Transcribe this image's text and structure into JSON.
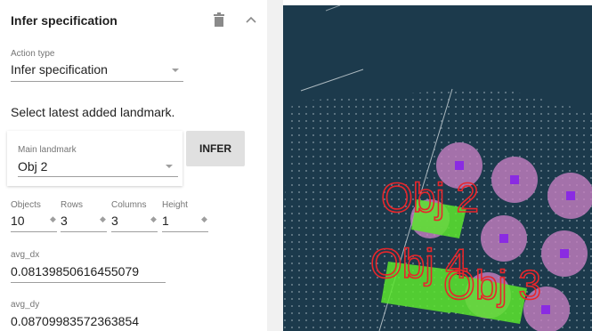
{
  "panel": {
    "title": "Infer specification",
    "icons": {
      "delete": "trash-icon",
      "collapse": "chevron-up-icon"
    },
    "action_type": {
      "label": "Action type",
      "value": "Infer specification"
    },
    "helper_text": "Select latest added landmark.",
    "main_landmark": {
      "label": "Main landmark",
      "value": "Obj 2"
    },
    "infer_button": "INFER",
    "fields": {
      "objects": {
        "label": "Objects",
        "value": "10"
      },
      "rows": {
        "label": "Rows",
        "value": "3"
      },
      "columns": {
        "label": "Columns",
        "value": "3"
      },
      "height": {
        "label": "Height",
        "value": "1"
      }
    },
    "avg_dx": {
      "label": "avg_dx",
      "value": "0.08139850616455079"
    },
    "avg_dy": {
      "label": "avg_dy",
      "value": "0.08709983572363854"
    }
  },
  "viewport": {
    "background": "#1c3a4c",
    "objects": [
      {
        "label": "Obj 2"
      },
      {
        "label": "Obj 4"
      },
      {
        "label": "Obj 3"
      }
    ],
    "colors": {
      "label": "#e8262b",
      "box": "#5ce62e",
      "circle": "#c77fc2",
      "marker": "#8a2be2"
    }
  }
}
